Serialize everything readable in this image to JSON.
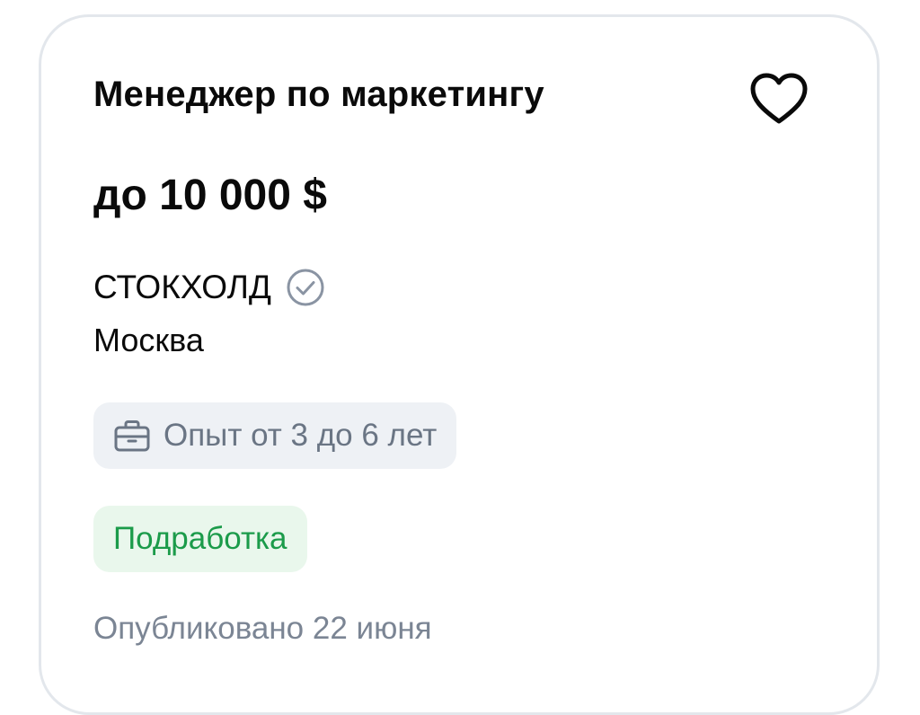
{
  "vacancy": {
    "title": "Менеджер по маркетингу",
    "salary": "до 10 000  $",
    "company": "СТОКХОЛД",
    "city": "Москва",
    "experience": "Опыт от 3 до 6 лет",
    "employment": "Подработка",
    "published": "Опубликовано 22 июня"
  },
  "icons": {
    "favorite": "heart-outline-icon",
    "verified": "check-circle-icon",
    "experience": "briefcase-icon"
  },
  "colors": {
    "text": "#0a0a0a",
    "muted": "#7b8594",
    "chip_gray_bg": "#eef1f5",
    "chip_green_bg": "#e9f7ec",
    "chip_green_text": "#1b9b4a",
    "card_border": "#e3e7ec"
  }
}
